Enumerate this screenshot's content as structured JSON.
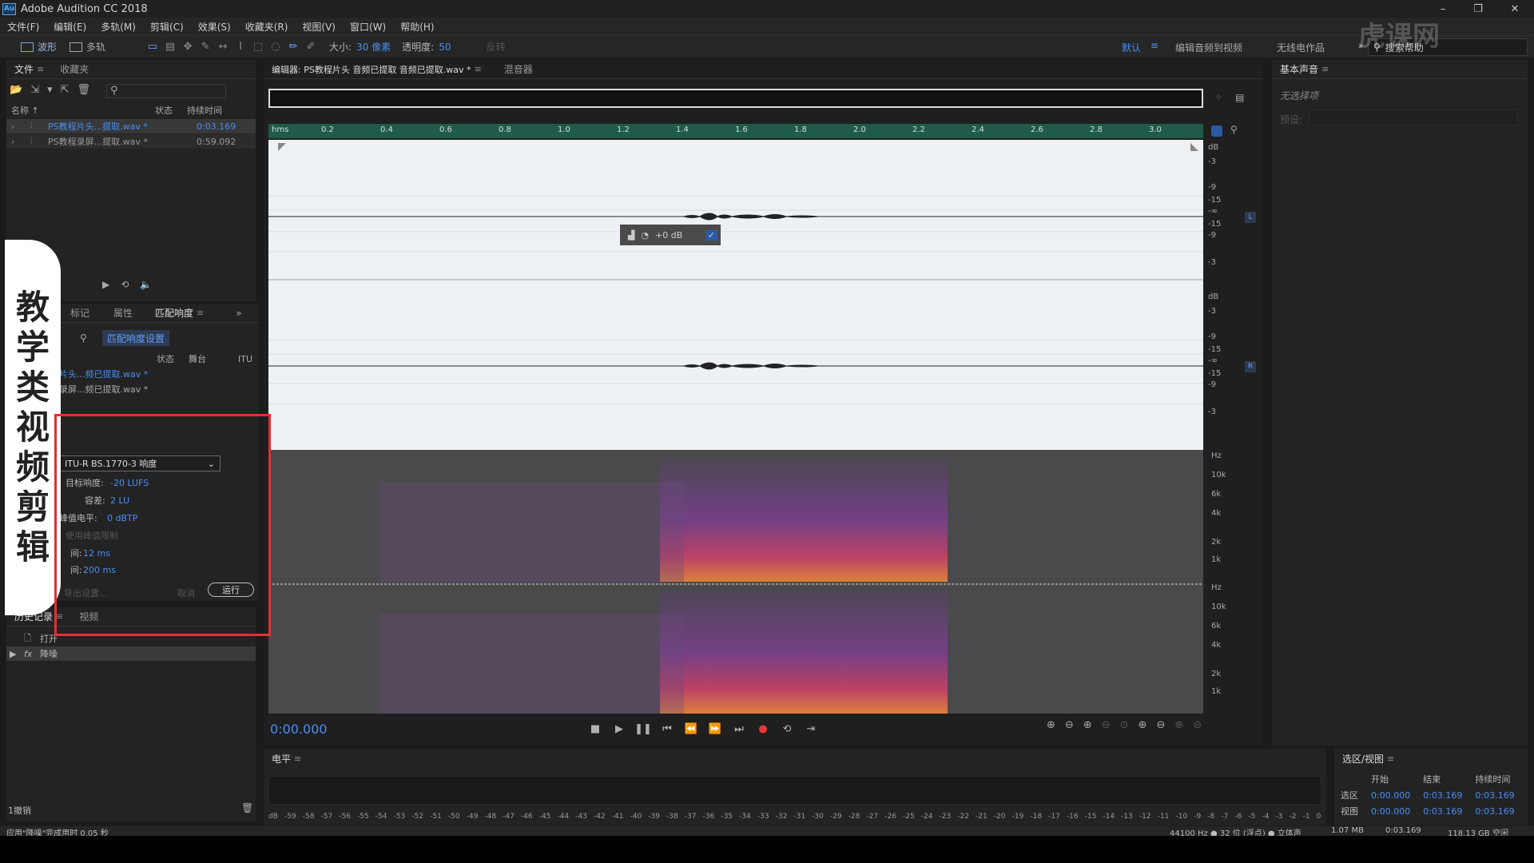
{
  "app": {
    "title": "Adobe Audition CC 2018",
    "logo": "Au"
  },
  "menu": [
    "文件(F)",
    "编辑(E)",
    "多轨(M)",
    "剪辑(C)",
    "效果(S)",
    "收藏夹(R)",
    "视图(V)",
    "窗口(W)",
    "帮助(H)"
  ],
  "toolbar": {
    "waveform_label": "波形",
    "multitrack_label": "多轨",
    "size_label": "大小:",
    "size_value": "30 像素",
    "opacity_label": "透明度:",
    "opacity_value": "50",
    "heal_label": "反转",
    "workspaces": [
      "默认",
      "编辑音频到视频",
      "无线电作品"
    ],
    "search_placeholder": "搜索帮助"
  },
  "files_panel": {
    "tabs": [
      "文件",
      "收藏夹"
    ],
    "columns": [
      "名称 ↑",
      "状态",
      "持续时间"
    ],
    "items": [
      {
        "name": "PS教程片头...提取.wav *",
        "duration": "0:03.169"
      },
      {
        "name": "PS教程录屏...提取.wav *",
        "duration": "0:59.092"
      }
    ]
  },
  "match_panel": {
    "tabs": [
      "标记",
      "属性",
      "匹配响度"
    ],
    "settings_button": "匹配响度设置",
    "columns": [
      "状态",
      "舞台",
      "ITU"
    ],
    "items": [
      "片头...频已提取.wav *",
      "录屏...频已提取.wav *"
    ],
    "standard": "ITU-R BS.1770-3 响度",
    "target_label": "目标响度:",
    "target_value": "-20 LUFS",
    "tolerance_label": "容差:",
    "tolerance_value": "2 LU",
    "peak_label": "峰值电平:",
    "peak_value": "0 dBTP",
    "limiter_label": "使用峰值限制",
    "lookahead_label": "间:",
    "lookahead_value": "12 ms",
    "release_label": "间:",
    "release_value": "200 ms",
    "export_button": "导出设置...",
    "cancel_button": "取消",
    "run_button": "运行"
  },
  "history_panel": {
    "tabs": [
      "历史记录",
      "视频"
    ],
    "items": [
      {
        "icon": "open-icon",
        "label": "打开"
      },
      {
        "icon": "fx-icon",
        "label": "降噪"
      }
    ],
    "undo_count": "1撤销"
  },
  "status_left": "应用\"降噪\"完成用时 0.05 秒",
  "editor": {
    "tabs": [
      "编辑器: PS教程片头 音频已提取 音频已提取.wav *",
      "混音器"
    ],
    "ruler_unit": "hms",
    "ruler_ticks": [
      "0.2",
      "0.4",
      "0.6",
      "0.8",
      "1.0",
      "1.2",
      "1.4",
      "1.6",
      "1.8",
      "2.0",
      "2.2",
      "2.4",
      "2.6",
      "2.8",
      "3.0"
    ],
    "gain_hud": "+0 dB",
    "channels": [
      "L",
      "R"
    ],
    "db_scale": [
      "dB",
      "-3",
      "-9",
      "-15",
      "-∞",
      "-15",
      "-9",
      "-3"
    ],
    "hz_scale": [
      "Hz",
      "10k",
      "6k",
      "4k",
      "2k",
      "1k"
    ],
    "time": "0:00.000"
  },
  "essential_sound": {
    "title": "基本声音",
    "no_selection": "无选择项",
    "preset_label": "预设:"
  },
  "levels": {
    "title": "电平",
    "scale": [
      "dB",
      "-59",
      "-58",
      "-57",
      "-56",
      "-55",
      "-54",
      "-53",
      "-52",
      "-51",
      "-50",
      "-49",
      "-48",
      "-47",
      "-46",
      "-45",
      "-44",
      "-43",
      "-42",
      "-41",
      "-40",
      "-39",
      "-38",
      "-37",
      "-36",
      "-35",
      "-34",
      "-33",
      "-32",
      "-31",
      "-30",
      "-29",
      "-28",
      "-27",
      "-26",
      "-25",
      "-24",
      "-23",
      "-22",
      "-21",
      "-20",
      "-19",
      "-18",
      "-17",
      "-16",
      "-15",
      "-14",
      "-13",
      "-12",
      "-11",
      "-10",
      "-9",
      "-8",
      "-7",
      "-6",
      "-5",
      "-4",
      "-3",
      "-2",
      "-1",
      "0"
    ]
  },
  "selection_view": {
    "title": "选区/视图",
    "headers": [
      "开始",
      "结束",
      "持续时间"
    ],
    "rows": [
      {
        "label": "选区",
        "start": "0:00.000",
        "end": "0:03.169",
        "duration": "0:03.169"
      },
      {
        "label": "视图",
        "start": "0:00.000",
        "end": "0:03.169",
        "duration": "0:03.169"
      }
    ]
  },
  "status_right": {
    "format": "44100 Hz ● 32 位 (浮点) ● 立体声",
    "size": "1.07 MB",
    "duration": "0:03.169",
    "free": "118.13 GB 空闲"
  },
  "overlay": {
    "chars": [
      "教",
      "学",
      "类",
      "视",
      "频",
      "剪",
      "辑"
    ],
    "watermark": "虎课网"
  }
}
